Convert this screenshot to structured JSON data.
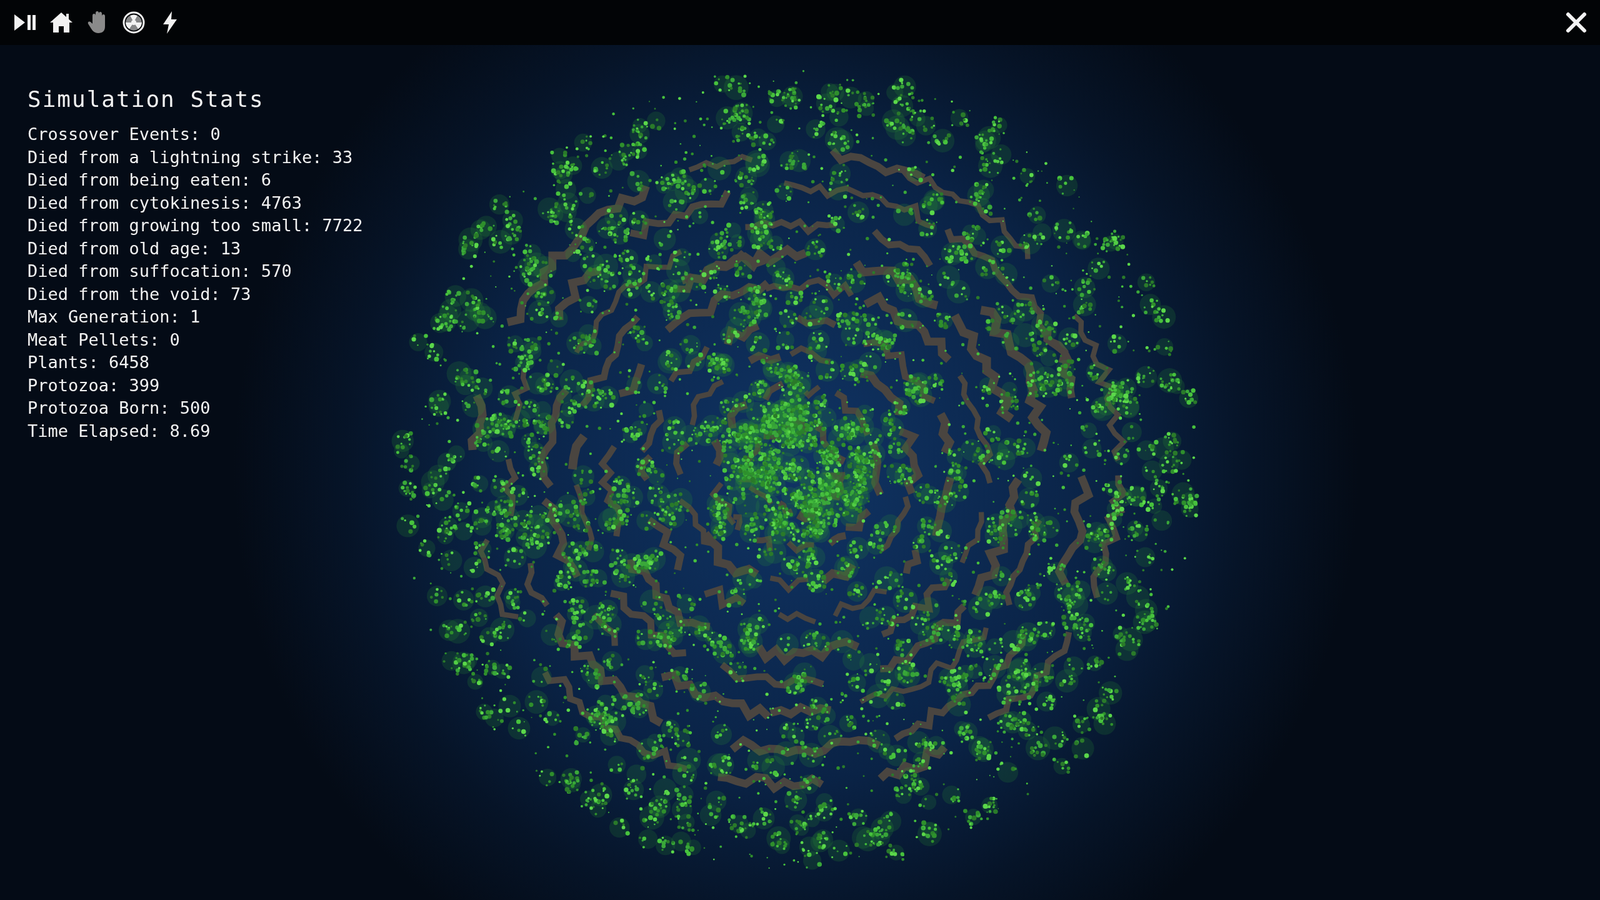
{
  "toolbar": {
    "buttons": [
      {
        "dimmed": false
      },
      {
        "dimmed": false
      },
      {
        "dimmed": true
      },
      {
        "dimmed": false
      },
      {
        "dimmed": false
      }
    ]
  },
  "stats_panel": {
    "title": "Simulation Stats",
    "lines": [
      "Crossover Events: 0",
      "Died from a lightning strike: 33",
      "Died from being eaten: 6",
      "Died from cytokinesis: 4763",
      "Died from growing too small: 7722",
      "Died from old age: 13",
      "Died from suffocation: 570",
      "Died from the void: 73",
      "Max Generation: 1",
      "Meat Pellets: 0",
      "Plants: 6458",
      "Protozoa: 399",
      "Protozoa Born: 500",
      "Time Elapsed: 8.69"
    ]
  }
}
